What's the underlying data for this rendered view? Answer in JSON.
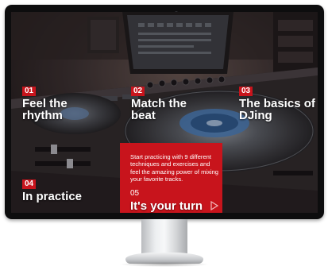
{
  "colors": {
    "accent": "#c8141c",
    "text": "#ffffff",
    "bezel": "#0d0d0e"
  },
  "lessons": [
    {
      "number": "01",
      "title": "Feel the rhythm"
    },
    {
      "number": "02",
      "title": "Match the beat"
    },
    {
      "number": "03",
      "title": "The basics of DJing"
    },
    {
      "number": "04",
      "title": "In practice"
    }
  ],
  "featured": {
    "description": "Start practicing with 9 different techniques and exercises and feel the amazing power of mixing your favorite tracks.",
    "number": "05",
    "title": "It's your turn",
    "icon": "play-arrow-icon"
  }
}
